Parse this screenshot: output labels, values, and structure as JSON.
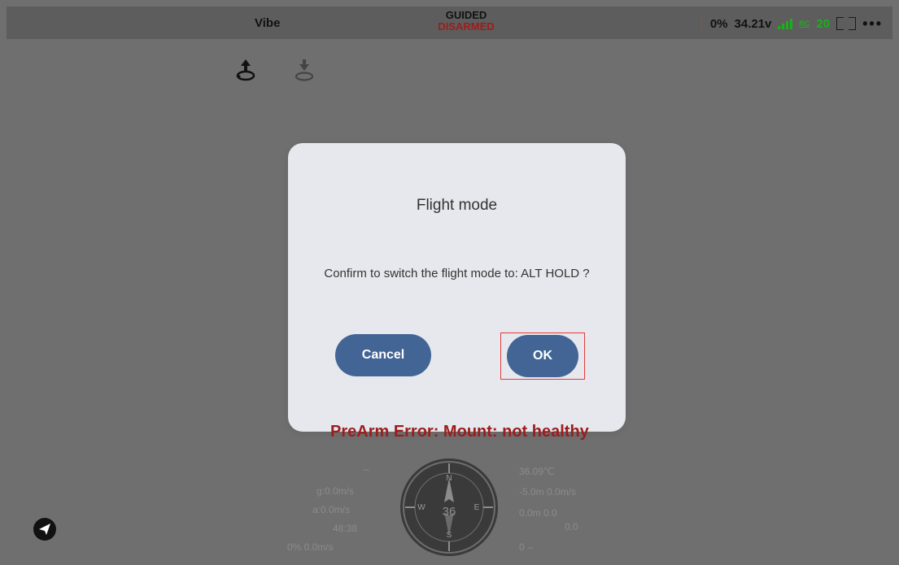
{
  "statusbar": {
    "app_label": "Vibe",
    "mode_main": "GUIDED",
    "mode_sub": "DISARMED",
    "battery_percent": "0%",
    "voltage": "34.21v",
    "rc_label": "RC",
    "rc_value": "20"
  },
  "dialog": {
    "title": "Flight mode",
    "message": "Confirm to switch the flight mode to: ALT HOLD ?",
    "cancel_label": "Cancel",
    "ok_label": "OK"
  },
  "warning_text": "PreArm Error: Mount: not healthy",
  "telemetry_left": {
    "line1": "--",
    "line2": "g:0.0m/s",
    "line3": "a:0.0m/s",
    "line4": "48:38",
    "line5": "0% 0.0m/s"
  },
  "telemetry_right": {
    "line1": "36.09℃",
    "line2": "-5.0m 0.0m/s",
    "line3": "0.0m 0.0",
    "line4": "0.0",
    "line5": "0 --"
  },
  "compass": {
    "heading": "36",
    "n": "N",
    "e": "E",
    "s": "S",
    "w": "W"
  }
}
